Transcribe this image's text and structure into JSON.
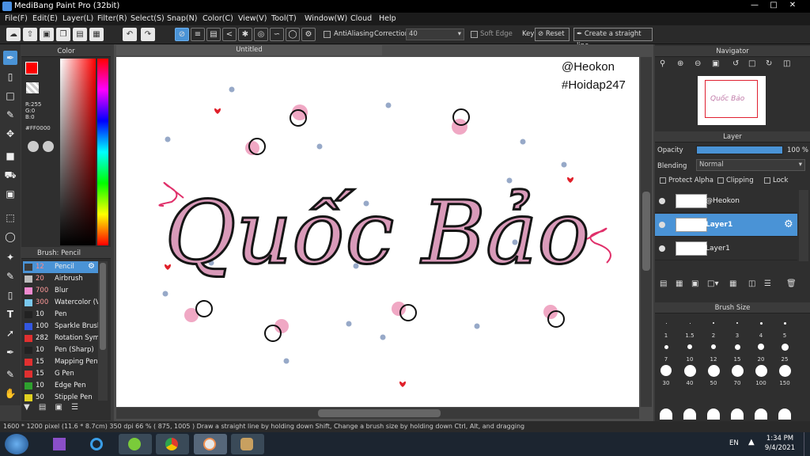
{
  "window": {
    "title": "MediBang Paint Pro (32bit)"
  },
  "menu": [
    "File(F)",
    "Edit(E)",
    "Layer(L)",
    "Filter(R)",
    "Select(S)",
    "Snap(N)",
    "Color(C)",
    "View(V)",
    "Tool(T)",
    "Window(W)",
    "Cloud",
    "Help"
  ],
  "toolbar": {
    "antialiasing_label": "AntiAliasing",
    "correction_label": "Correction",
    "correction_value": "40",
    "soft_edge_label": "Soft Edge",
    "key_label": "Key",
    "reset_label": "Reset",
    "straight_line_label": "Create a straight line"
  },
  "color_panel": {
    "title": "Color",
    "r": "R:255",
    "g": "G:0",
    "b": "B:0",
    "hex": "#FF0000",
    "primary_color": "#ff0000"
  },
  "brush_panel": {
    "title": "Brush: Pencil",
    "items": [
      {
        "size": "12",
        "name": "Pencil",
        "color": "#3c3c3c",
        "selected": true
      },
      {
        "size": "20",
        "name": "Airbrush",
        "color": "#bdbdbd"
      },
      {
        "size": "700",
        "name": "Blur",
        "color": "#f08ad0"
      },
      {
        "size": "300",
        "name": "Watercolor (V",
        "color": "#7ac8ee"
      },
      {
        "size": "10",
        "name": "Pen",
        "color": "#222222"
      },
      {
        "size": "100",
        "name": "Sparkle Brush",
        "color": "#3357e0"
      },
      {
        "size": "282",
        "name": "Rotation Sym",
        "color": "#e03030"
      },
      {
        "size": "10",
        "name": "Pen (Sharp)",
        "color": "#222222"
      },
      {
        "size": "15",
        "name": "Mapping Pen",
        "color": "#e03030"
      },
      {
        "size": "15",
        "name": "G Pen",
        "color": "#e03030"
      },
      {
        "size": "10",
        "name": "Edge Pen",
        "color": "#2ea02e"
      },
      {
        "size": "50",
        "name": "Stipple Pen",
        "color": "#e0d020"
      }
    ]
  },
  "document": {
    "tab_title": "Untitled",
    "watermark_line1": "@Heokon",
    "watermark_line2": "#Hoidap247",
    "artwork_text": "Quốc Bảo"
  },
  "navigator": {
    "title": "Navigator"
  },
  "layer_panel": {
    "title": "Layer",
    "opacity_label": "Opacity",
    "opacity_value": "100 %",
    "opacity_fraction": 1.0,
    "blending_label": "Blending",
    "blending_value": "Normal",
    "protect_alpha_label": "Protect Alpha",
    "clipping_label": "Clipping",
    "lock_label": "Lock",
    "layers": [
      {
        "name": "@Heokon",
        "selected": false
      },
      {
        "name": "Layer1",
        "selected": true
      },
      {
        "name": "Layer1",
        "selected": false
      }
    ]
  },
  "brush_size_panel": {
    "title": "Brush Size",
    "rows": [
      [
        "1",
        "1.5",
        "2",
        "3",
        "4",
        "5"
      ],
      [
        "7",
        "10",
        "12",
        "15",
        "20",
        "25"
      ],
      [
        "30",
        "40",
        "50",
        "70",
        "100",
        "150"
      ]
    ]
  },
  "status": {
    "text": "1600 * 1200 pixel   (11.6 * 8.7cm)  350 dpi   66 %   ( 875, 1005 )   Draw a straight line by holding down Shift, Change a brush size by holding down Ctrl, Alt, and dragging"
  },
  "taskbar": {
    "lang": "EN",
    "time": "1:34 PM",
    "date": "9/4/2021"
  },
  "colors": {
    "accent": "#3a8fd8",
    "selected_layer": "#4a93d6",
    "canvas_bg": "#ffffff",
    "letter_fill": "#d99ab9",
    "dots": "#97a9c8"
  }
}
